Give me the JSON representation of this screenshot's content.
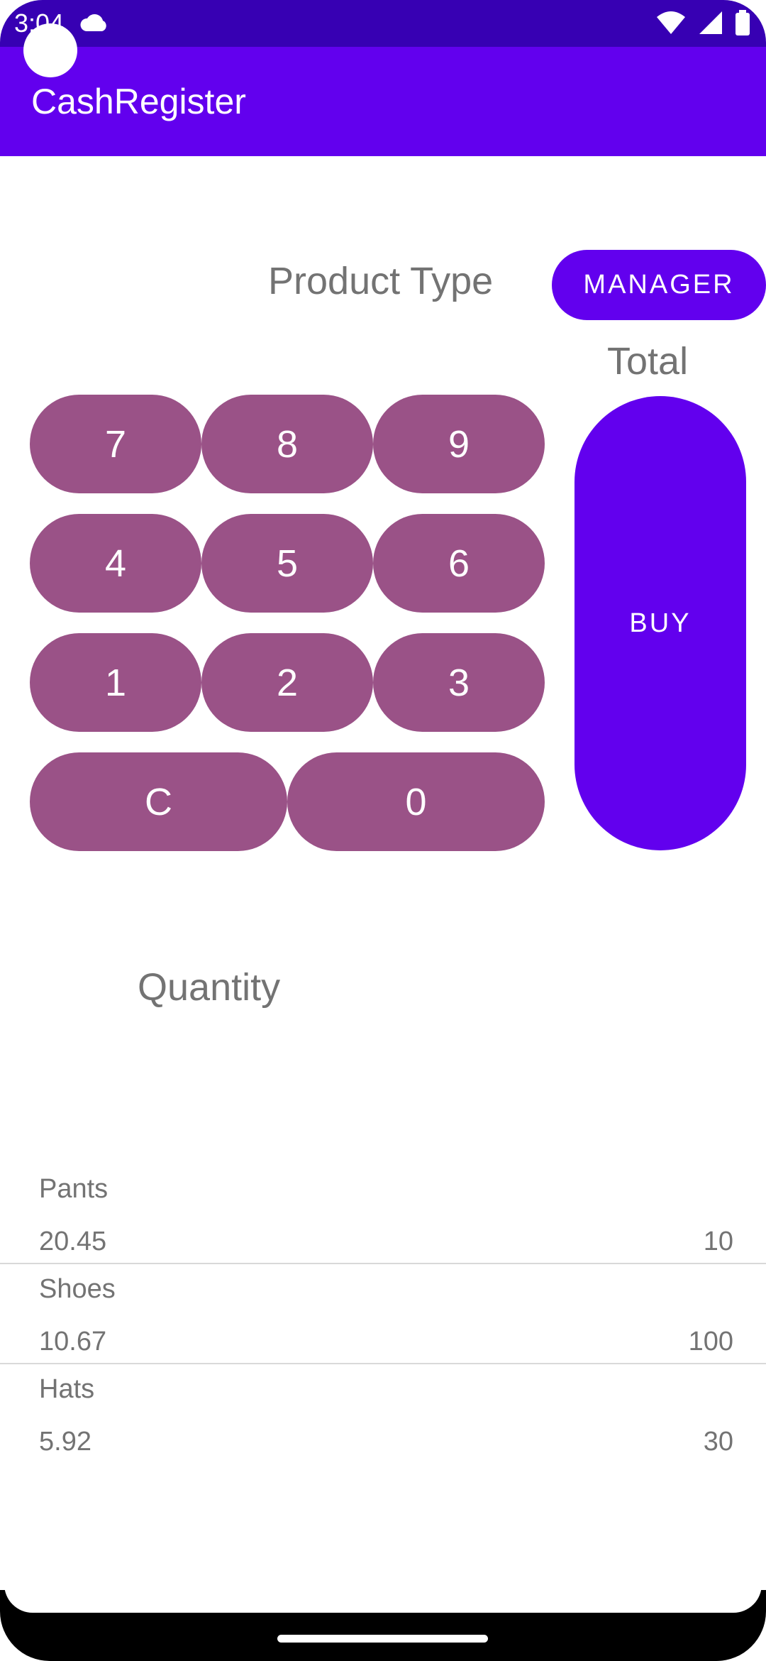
{
  "status_bar": {
    "time": "3:04"
  },
  "app_bar": {
    "title": "CashRegister"
  },
  "labels": {
    "product_type": "Product Type",
    "total": "Total",
    "quantity": "Quantity"
  },
  "buttons": {
    "manager": "MANAGER",
    "buy": "BUY"
  },
  "keypad": {
    "k7": "7",
    "k8": "8",
    "k9": "9",
    "k4": "4",
    "k5": "5",
    "k6": "6",
    "k1": "1",
    "k2": "2",
    "k3": "3",
    "clear": "C",
    "k0": "0"
  },
  "products": [
    {
      "name": "Pants",
      "price": "20.45",
      "quantity": "10"
    },
    {
      "name": "Shoes",
      "price": "10.67",
      "quantity": "100"
    },
    {
      "name": "Hats",
      "price": "5.92",
      "quantity": "30"
    }
  ],
  "colors": {
    "status_bar": "#3700b3",
    "primary": "#6200ee",
    "keypad": "#9a5287",
    "text_secondary": "#737373"
  }
}
